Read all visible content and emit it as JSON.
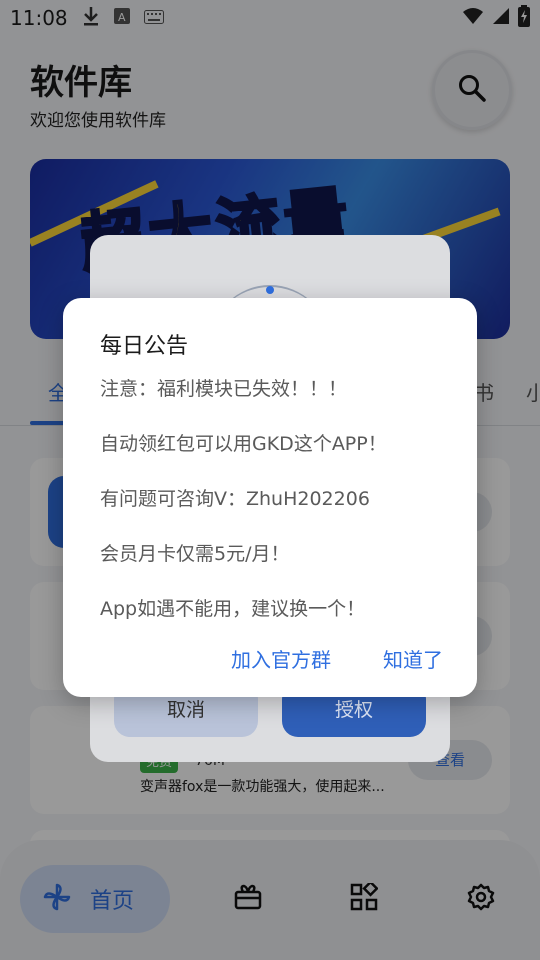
{
  "status_bar": {
    "time": "11:08",
    "icons": [
      "download-icon",
      "a-notification-icon",
      "keyboard-icon",
      "wifi-icon",
      "signal-icon",
      "battery-charging-icon"
    ]
  },
  "header": {
    "title": "软件库",
    "subtitle": "欢迎您使用软件库"
  },
  "banner": {
    "text": "超大流量"
  },
  "tabs": [
    {
      "label": "全",
      "active": true
    },
    {
      "label": "书",
      "active": false
    },
    {
      "label": "小",
      "active": false
    }
  ],
  "list": {
    "card3": {
      "badge": "免费",
      "size": "76M",
      "description": "变声器fox是一款功能强大，使用起来...",
      "button": "查看"
    }
  },
  "bottom_nav": {
    "home_label": "首页",
    "items": [
      "home-pinwheel-icon",
      "gift-box-icon",
      "apps-grid-icon",
      "settings-gear-icon"
    ]
  },
  "loading_dialog": {
    "cancel_label": "取消",
    "authorize_label": "授权"
  },
  "dialog": {
    "title": "每日公告",
    "lines": [
      "注意：福利模块已失效！！！",
      "自动领红包可以用GKD这个APP！",
      "有问题可咨询V：ZhuH202206",
      "会员月卡仅需5元/月！",
      "App如遇不能用，建议换一个！"
    ],
    "join_group_label": "加入官方群",
    "ok_label": "知道了"
  },
  "colors": {
    "accent": "#2f6fe0",
    "free_badge": "#3cb44a",
    "banner_yellow": "#ffdd33"
  }
}
